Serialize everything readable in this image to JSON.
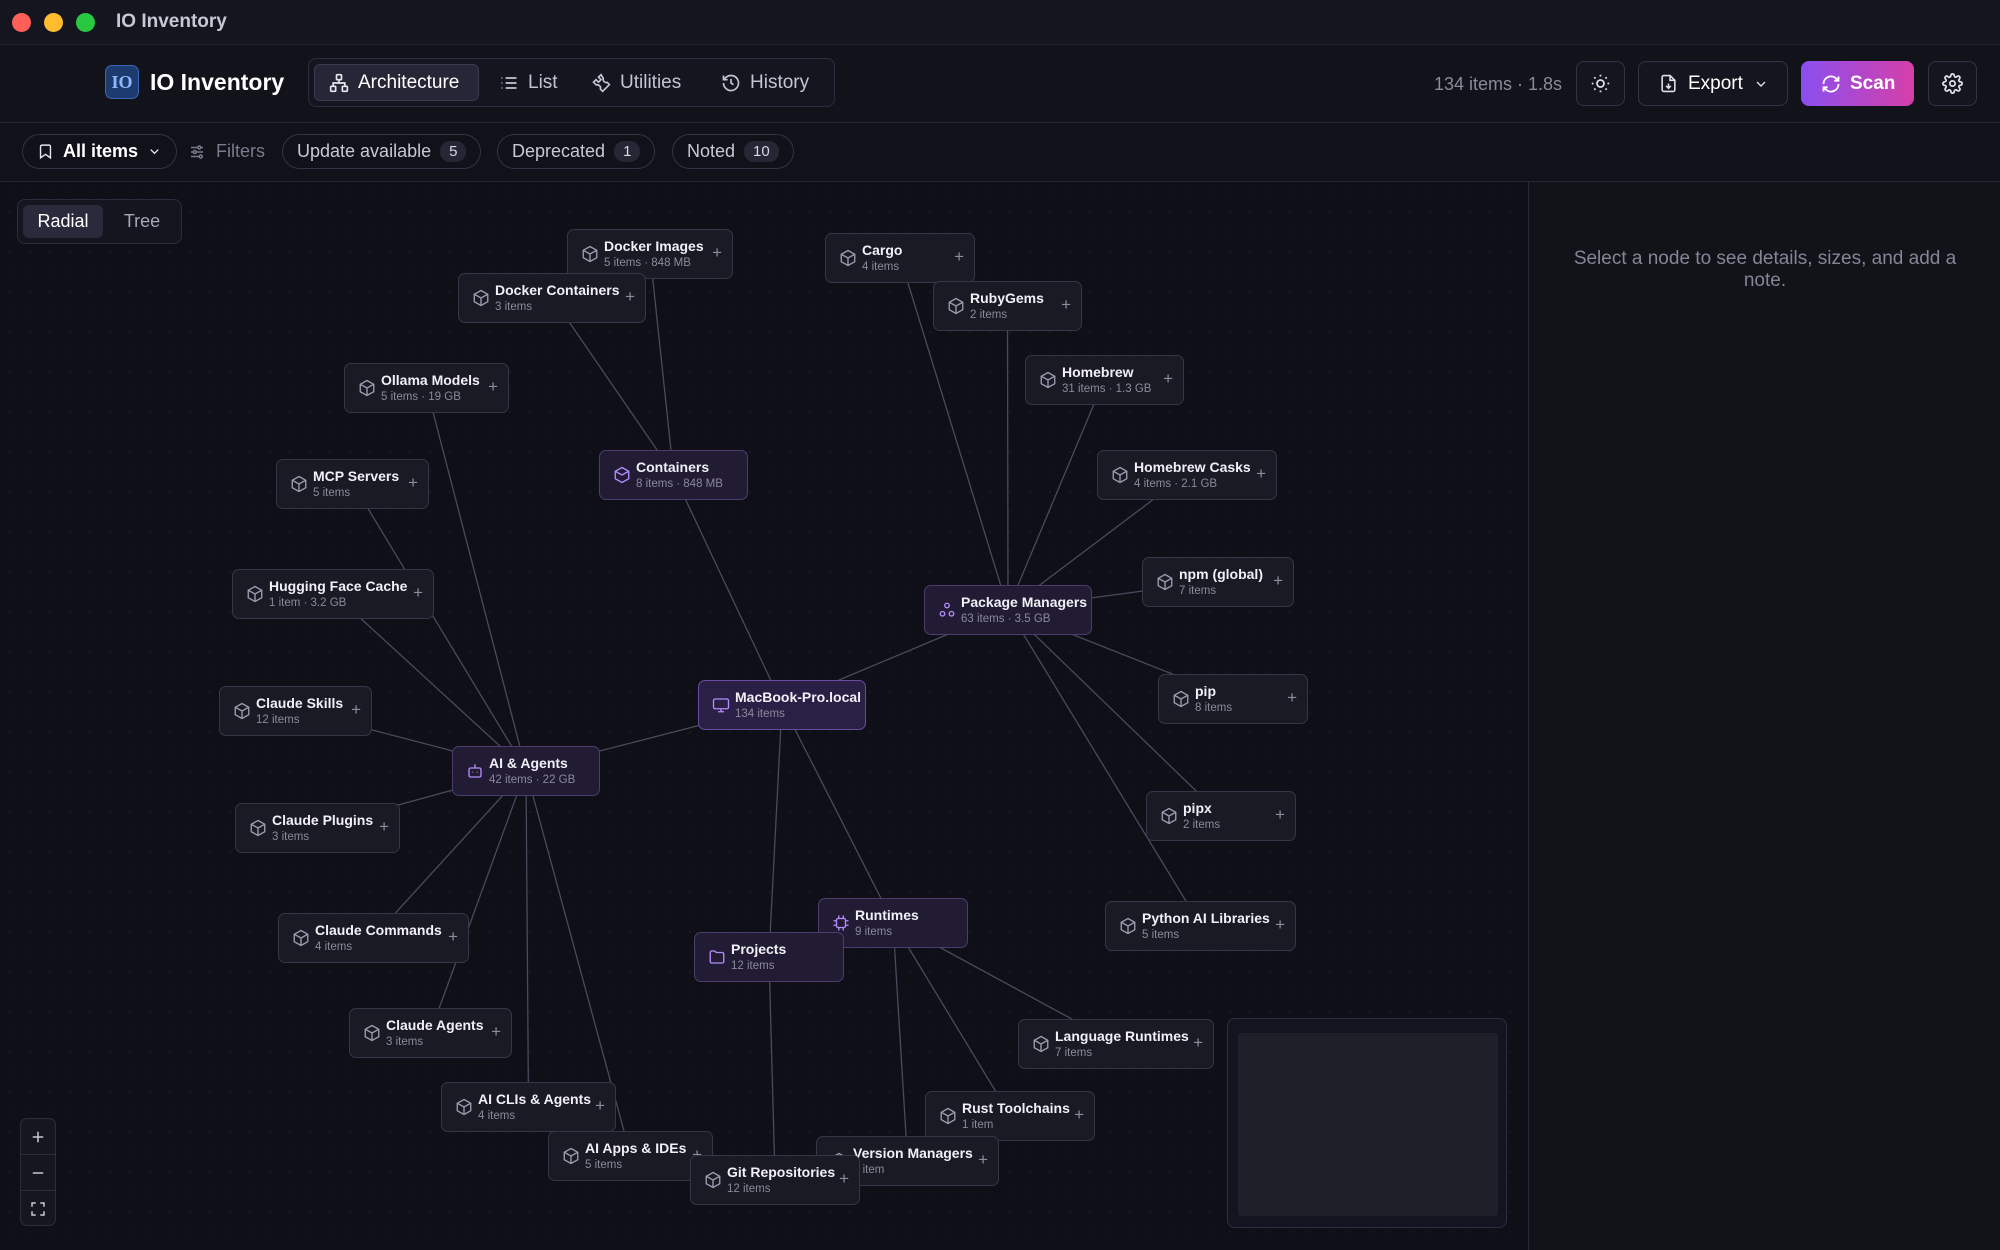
{
  "window": {
    "title": "IO Inventory"
  },
  "header": {
    "logo_text": "IO",
    "app_name": "IO Inventory",
    "tabs": [
      {
        "label": "Architecture",
        "icon": "sitemap-icon",
        "active": true
      },
      {
        "label": "List",
        "icon": "list-icon",
        "active": false
      },
      {
        "label": "Utilities",
        "icon": "wrench-icon",
        "active": false
      },
      {
        "label": "History",
        "icon": "history-icon",
        "active": false
      }
    ],
    "stats": "134 items · 1.8s",
    "export_label": "Export",
    "scan_label": "Scan"
  },
  "filters": {
    "view_label": "All items",
    "filters_label": "Filters",
    "pills": [
      {
        "label": "Update available",
        "count": "5"
      },
      {
        "label": "Deprecated",
        "count": "1"
      },
      {
        "label": "Noted",
        "count": "10"
      }
    ]
  },
  "view_toggle": {
    "radial": "Radial",
    "tree": "Tree",
    "active": "Radial"
  },
  "graph": {
    "root": {
      "id": "root",
      "name": "MacBook-Pro.local",
      "sub": "134 items"
    },
    "categories": [
      {
        "id": "ai",
        "name": "AI & Agents",
        "sub": "42 items · 22 GB"
      },
      {
        "id": "containers",
        "name": "Containers",
        "sub": "8 items · 848 MB"
      },
      {
        "id": "pkg",
        "name": "Package Managers",
        "sub": "63 items · 3.5 GB"
      },
      {
        "id": "runtimes",
        "name": "Runtimes",
        "sub": "9 items"
      },
      {
        "id": "projects",
        "name": "Projects",
        "sub": "12 items"
      }
    ],
    "leaves": [
      {
        "id": "docker-images",
        "parent": "containers",
        "name": "Docker Images",
        "sub": "5 items · 848 MB"
      },
      {
        "id": "docker-containers",
        "parent": "containers",
        "name": "Docker Containers",
        "sub": "3 items"
      },
      {
        "id": "ollama",
        "parent": "ai",
        "name": "Ollama Models",
        "sub": "5 items · 19 GB"
      },
      {
        "id": "mcp",
        "parent": "ai",
        "name": "MCP Servers",
        "sub": "5 items"
      },
      {
        "id": "hf",
        "parent": "ai",
        "name": "Hugging Face Cache",
        "sub": "1 item · 3.2 GB"
      },
      {
        "id": "skills",
        "parent": "ai",
        "name": "Claude Skills",
        "sub": "12 items"
      },
      {
        "id": "plugins",
        "parent": "ai",
        "name": "Claude Plugins",
        "sub": "3 items"
      },
      {
        "id": "commands",
        "parent": "ai",
        "name": "Claude Commands",
        "sub": "4 items"
      },
      {
        "id": "agents",
        "parent": "ai",
        "name": "Claude Agents",
        "sub": "3 items"
      },
      {
        "id": "clis",
        "parent": "ai",
        "name": "AI CLIs & Agents",
        "sub": "4 items"
      },
      {
        "id": "apps",
        "parent": "ai",
        "name": "AI Apps & IDEs",
        "sub": "5 items"
      },
      {
        "id": "cargo",
        "parent": "pkg",
        "name": "Cargo",
        "sub": "4 items"
      },
      {
        "id": "gems",
        "parent": "pkg",
        "name": "RubyGems",
        "sub": "2 items"
      },
      {
        "id": "brew",
        "parent": "pkg",
        "name": "Homebrew",
        "sub": "31 items · 1.3 GB"
      },
      {
        "id": "casks",
        "parent": "pkg",
        "name": "Homebrew Casks",
        "sub": "4 items · 2.1 GB"
      },
      {
        "id": "npm",
        "parent": "pkg",
        "name": "npm (global)",
        "sub": "7 items"
      },
      {
        "id": "pip",
        "parent": "pkg",
        "name": "pip",
        "sub": "8 items"
      },
      {
        "id": "pipx",
        "parent": "pkg",
        "name": "pipx",
        "sub": "2 items"
      },
      {
        "id": "pyai",
        "parent": "pkg",
        "name": "Python AI Libraries",
        "sub": "5 items"
      },
      {
        "id": "langrt",
        "parent": "runtimes",
        "name": "Language Runtimes",
        "sub": "7 items"
      },
      {
        "id": "rust",
        "parent": "runtimes",
        "name": "Rust Toolchains",
        "sub": "1 item"
      },
      {
        "id": "vm",
        "parent": "runtimes",
        "name": "Version Managers",
        "sub": "1 item"
      },
      {
        "id": "git",
        "parent": "projects",
        "name": "Git Repositories",
        "sub": "12 items"
      }
    ]
  },
  "detail_panel": {
    "hint": "Select a node to see details, sizes, and add a note."
  },
  "colors": {
    "accent": "#a77bff",
    "scan_start": "#8a4ff0",
    "scan_end": "#d63fa8",
    "background": "#0f0f18"
  }
}
